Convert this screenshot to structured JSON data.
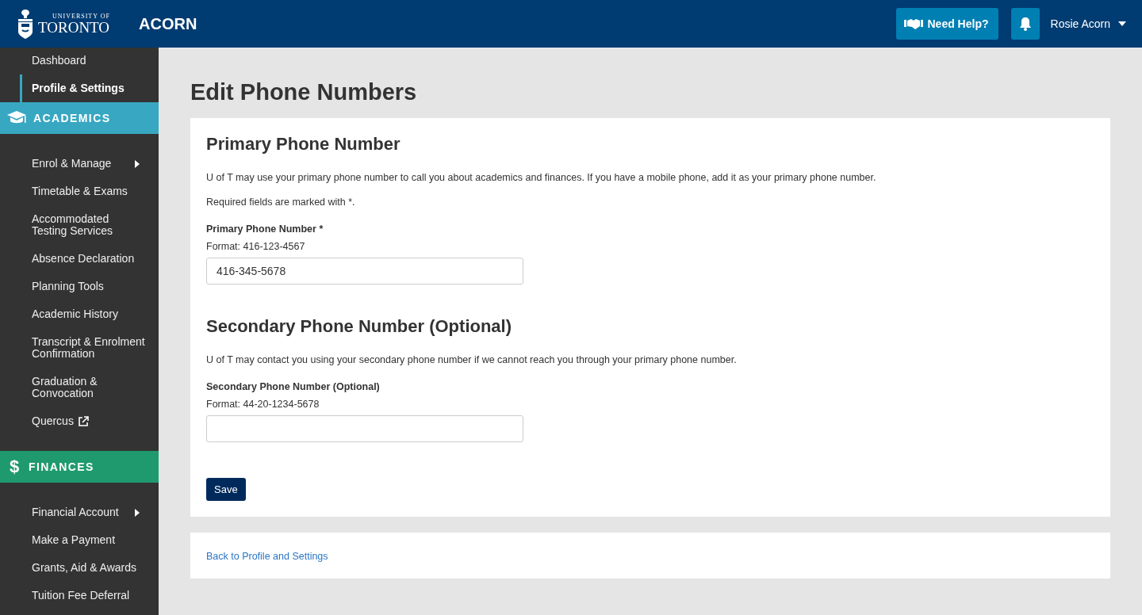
{
  "header": {
    "logo": {
      "line_1": "UNIVERSITY OF",
      "line_2": "TORONTO"
    },
    "app_name": "ACORN",
    "help_button": "Need Help?",
    "user_menu": "Rosie Acorn"
  },
  "sidebar": {
    "items": [
      {
        "label": "Dashboard",
        "selected": false
      },
      {
        "label": "Profile & Settings",
        "selected": true
      }
    ],
    "sections": [
      {
        "title": "ACADEMICS",
        "kind": "cap",
        "color": "#38a7c2",
        "items": [
          {
            "label": "Enrol & Manage",
            "kind": "submenu"
          },
          {
            "label": "Timetable & Exams",
            "kind": "plain"
          },
          {
            "label": "Accommodated Testing Services",
            "kind": "plain"
          },
          {
            "label": "Absence Declaration",
            "kind": "plain"
          },
          {
            "label": "Planning Tools",
            "kind": "plain"
          },
          {
            "label": "Academic History",
            "kind": "plain"
          },
          {
            "label": "Transcript & Enrolment Confirmation",
            "kind": "plain"
          },
          {
            "label": "Graduation & Convocation",
            "kind": "plain"
          },
          {
            "label": "Quercus",
            "kind": "external"
          }
        ]
      },
      {
        "title": "FINANCES",
        "kind": "symbol",
        "symbol": "$",
        "color": "#1f9a6f",
        "items": [
          {
            "label": "Financial Account",
            "kind": "submenu"
          },
          {
            "label": "Make a Payment",
            "kind": "plain"
          },
          {
            "label": "Grants, Aid & Awards",
            "kind": "plain"
          },
          {
            "label": "Tuition Fee Deferral",
            "kind": "plain"
          }
        ]
      }
    ]
  },
  "page_title": "Edit Phone Numbers",
  "form": {
    "sections": [
      {
        "heading": "Primary Phone Number",
        "paragraphs": [
          "U of T may use your primary phone number to call you about academics and finances. If you have a mobile phone, add it as your primary phone number.",
          "Required fields are marked with *."
        ],
        "field": {
          "label": "Primary Phone Number *",
          "hint": "Format: 416-123-4567",
          "value": "416-345-5678"
        }
      },
      {
        "heading": "Secondary Phone Number (Optional)",
        "paragraphs": [
          "U of T may contact you using your secondary phone number if we cannot reach you through your primary phone number."
        ],
        "field": {
          "label": "Secondary Phone Number (Optional)",
          "hint": "Format: 44-20-1234-5678"
        }
      }
    ],
    "save_button": "Save"
  },
  "back_link": "Back to Profile and Settings"
}
